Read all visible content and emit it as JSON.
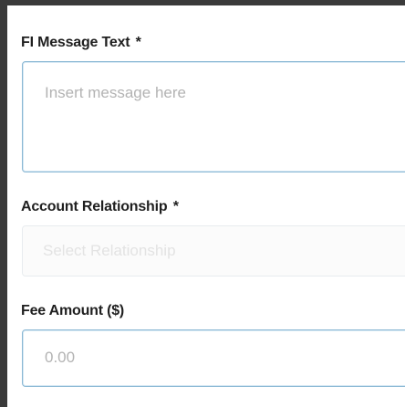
{
  "form": {
    "message": {
      "label": "FI Message Text",
      "required_mark": "*",
      "placeholder": "Insert message here"
    },
    "relationship": {
      "label": "Account Relationship",
      "required_mark": "*",
      "placeholder": "Select Relationship"
    },
    "fee": {
      "label": "Fee Amount ($)",
      "placeholder": "0.00"
    }
  }
}
